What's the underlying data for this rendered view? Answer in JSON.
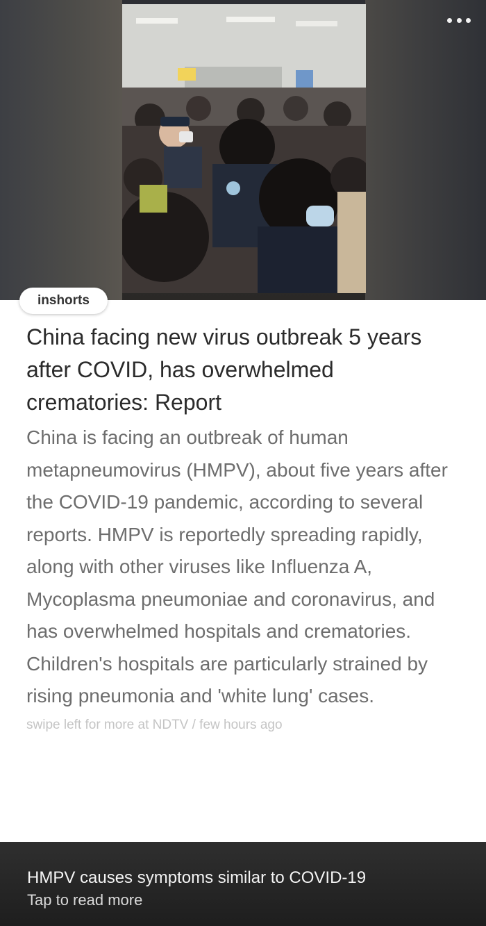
{
  "hero": {
    "more_icon": "more-horizontal-icon"
  },
  "source_badge": {
    "label": "inshorts"
  },
  "article": {
    "headline": "China facing new virus outbreak 5 years after COVID, has overwhelmed crematories: Report",
    "body": "China is facing an outbreak of human metapneumovirus (HMPV), about five years after the COVID-19 pandemic, according to several reports. HMPV is reportedly spreading rapidly, along with other viruses like Influenza A, Mycoplasma pneumoniae and coronavirus, and has overwhelmed hospitals and crematories. Children's hospitals are particularly strained by rising pneumonia and 'white lung' cases.",
    "meta": "swipe left for more at NDTV / few hours ago"
  },
  "footer": {
    "title": "HMPV causes symptoms similar to COVID-19",
    "subtitle": "Tap to read more"
  },
  "colors": {
    "headline": "#2b2b2b",
    "body": "#6d6d6d",
    "meta": "#c4c4c4",
    "footer_bg": "#262626"
  }
}
